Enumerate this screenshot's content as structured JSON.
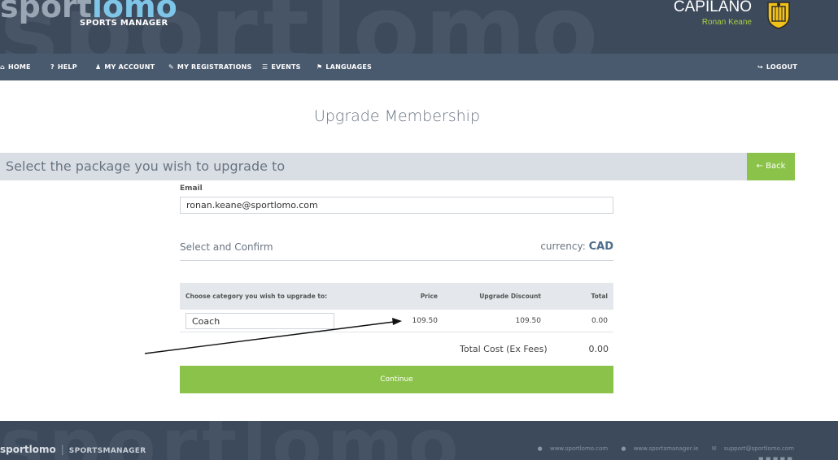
{
  "header": {
    "background_wordmark": "sportlomo",
    "logo_sport": "sport",
    "logo_lomo": "lomo",
    "logo_subtitle": "SPORTS MANAGER",
    "club_name": "CAPILANO",
    "user_name": "Ronan Keane"
  },
  "nav": {
    "items": [
      {
        "icon": "home-icon",
        "label": "HOME"
      },
      {
        "icon": "help-icon",
        "label": "HELP"
      },
      {
        "icon": "user-icon",
        "label": "MY ACCOUNT"
      },
      {
        "icon": "edit-icon",
        "label": "MY REGISTRATIONS"
      },
      {
        "icon": "list-icon",
        "label": "EVENTS"
      },
      {
        "icon": "flag-icon",
        "label": "LANGUAGES"
      }
    ],
    "logout_label": "LOGOUT"
  },
  "page": {
    "title": "Upgrade Membership",
    "section_title": "Select the package you wish to upgrade to",
    "back_label": "Back"
  },
  "form": {
    "email_label": "Email",
    "email_value": "ronan.keane@sportlomo.com",
    "confirm_title": "Select and Confirm",
    "currency_label": "currency:",
    "currency_value": "CAD",
    "table": {
      "headers": [
        "Choose category you wish to upgrade to:",
        "Price",
        "Upgrade Discount",
        "Total"
      ],
      "row": {
        "category": "Coach",
        "price": "109.50",
        "discount": "109.50",
        "total": "0.00"
      },
      "total_label": "Total Cost (Ex Fees)",
      "total_value": "0.00"
    },
    "continue_label": "Continue"
  },
  "footer": {
    "background_wordmark": "sportlomo",
    "logo": "sportlomo",
    "logo_sub": "SPORTSMANAGER",
    "links": [
      "www.sportlomo.com",
      "www.sportsmanager.ie",
      "support@sportlomo.com"
    ]
  },
  "colors": {
    "header_bg": "#3c4a5b",
    "nav_bg": "#4a5a6e",
    "accent_green": "#8bc34a",
    "section_bar_bg": "#d9dee4"
  }
}
